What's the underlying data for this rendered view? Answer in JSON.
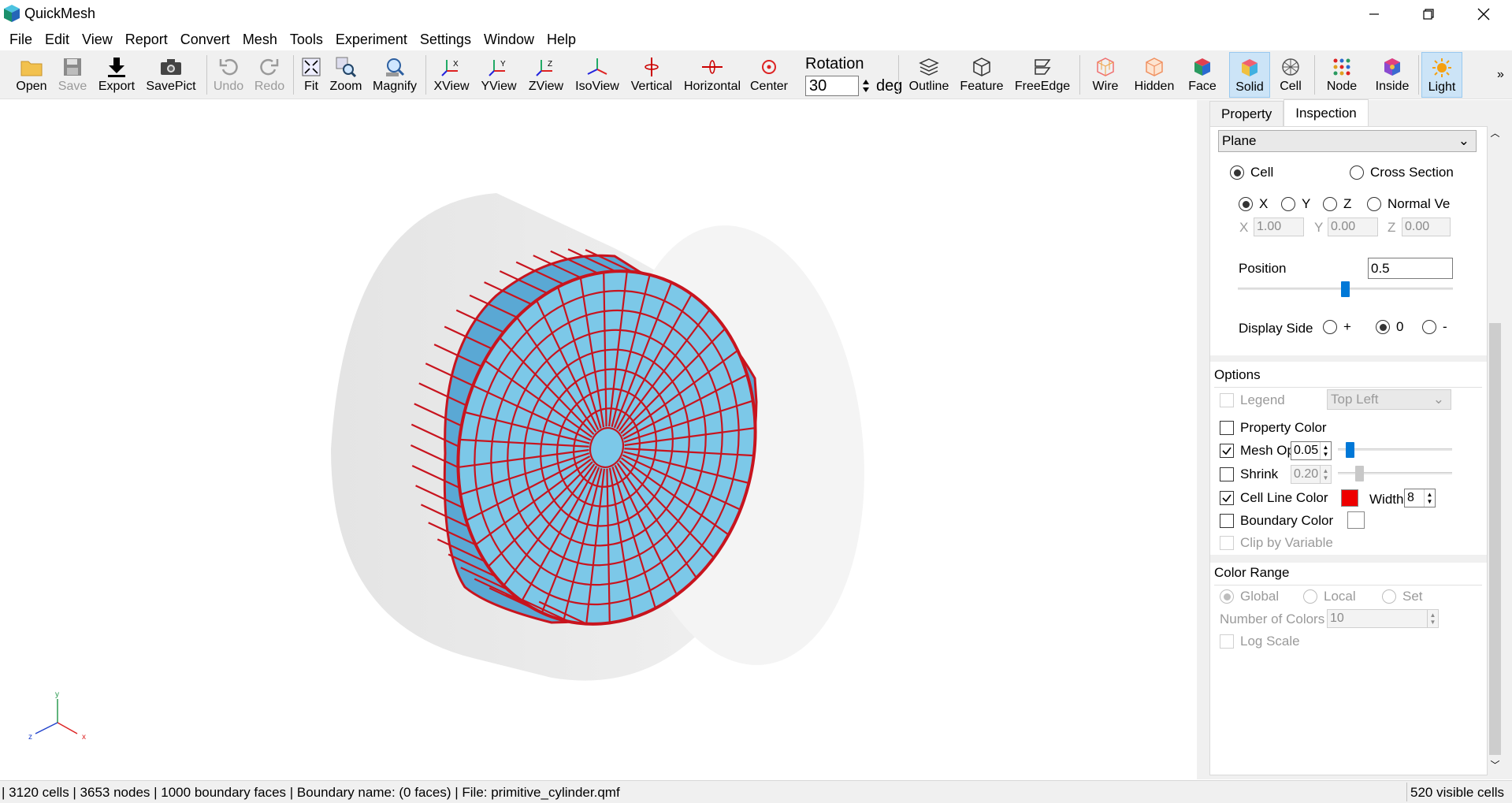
{
  "window": {
    "title": "QuickMesh"
  },
  "menu": [
    "File",
    "Edit",
    "View",
    "Report",
    "Convert",
    "Mesh",
    "Tools",
    "Experiment",
    "Settings",
    "Window",
    "Help"
  ],
  "toolbar": {
    "open": "Open",
    "save": "Save",
    "export": "Export",
    "savepict": "SavePict",
    "undo": "Undo",
    "redo": "Redo",
    "fit": "Fit",
    "zoom": "Zoom",
    "magnify": "Magnify",
    "xview": "XView",
    "yview": "YView",
    "zview": "ZView",
    "isoview": "IsoView",
    "vertical": "Vertical",
    "horizontal": "Horizontal",
    "center": "Center",
    "rotation_label": "Rotation",
    "rotation_value": "30",
    "rotation_unit": "deg",
    "outline": "Outline",
    "feature": "Feature",
    "freeedge": "FreeEdge",
    "wire": "Wire",
    "hidden": "Hidden",
    "face": "Face",
    "solid": "Solid",
    "cell": "Cell",
    "node": "Node",
    "inside": "Inside",
    "light": "Light",
    "overflow": "»"
  },
  "panel": {
    "tabs": [
      "Property",
      "Inspection"
    ],
    "active_tab": "Inspection",
    "plane_select": "Plane",
    "mode_cell": "Cell",
    "mode_cross_section": "Cross Section",
    "axis_x": "X",
    "axis_y": "Y",
    "axis_z": "Z",
    "axis_normal": "Normal Ve",
    "vec_x_label": "X",
    "vec_x": "1.00",
    "vec_y_label": "Y",
    "vec_y": "0.00",
    "vec_z_label": "Z",
    "vec_z": "0.00",
    "position_label": "Position",
    "position_value": "0.5",
    "position_slider": 0.5,
    "display_side_label": "Display Side",
    "side_plus": "+",
    "side_zero": "0",
    "side_minus": "-",
    "options_title": "Options",
    "legend": "Legend",
    "legend_pos": "Top Left",
    "property_color": "Property Color",
    "mesh_opacity": "Mesh Opa",
    "mesh_opacity_value": "0.05",
    "shrink": "Shrink",
    "shrink_value": "0.20",
    "cell_line_color": "Cell Line Color",
    "cell_line_color_hex": "#ee0000",
    "width_label": "Width",
    "width_value": "8",
    "boundary_color": "Boundary Color",
    "clip_by_variable": "Clip by Variable",
    "color_range_title": "Color Range",
    "cr_global": "Global",
    "cr_local": "Local",
    "cr_set": "Set",
    "num_colors_label": "Number of Colors",
    "num_colors_value": "10",
    "log_scale": "Log Scale"
  },
  "status": {
    "left": "| 3120 cells | 3653 nodes | 1000 boundary faces |  Boundary name:  (0 faces) | File: primitive_cylinder.qmf",
    "right": "520 visible cells"
  },
  "axes": {
    "x": "x",
    "y": "y",
    "z": "z"
  },
  "colors": {
    "mesh_line": "#c8141e",
    "mesh_face": "#7cc8e8",
    "mesh_face_dark": "#5aa8d4",
    "ghost_cylinder": "#e8e8e8"
  }
}
